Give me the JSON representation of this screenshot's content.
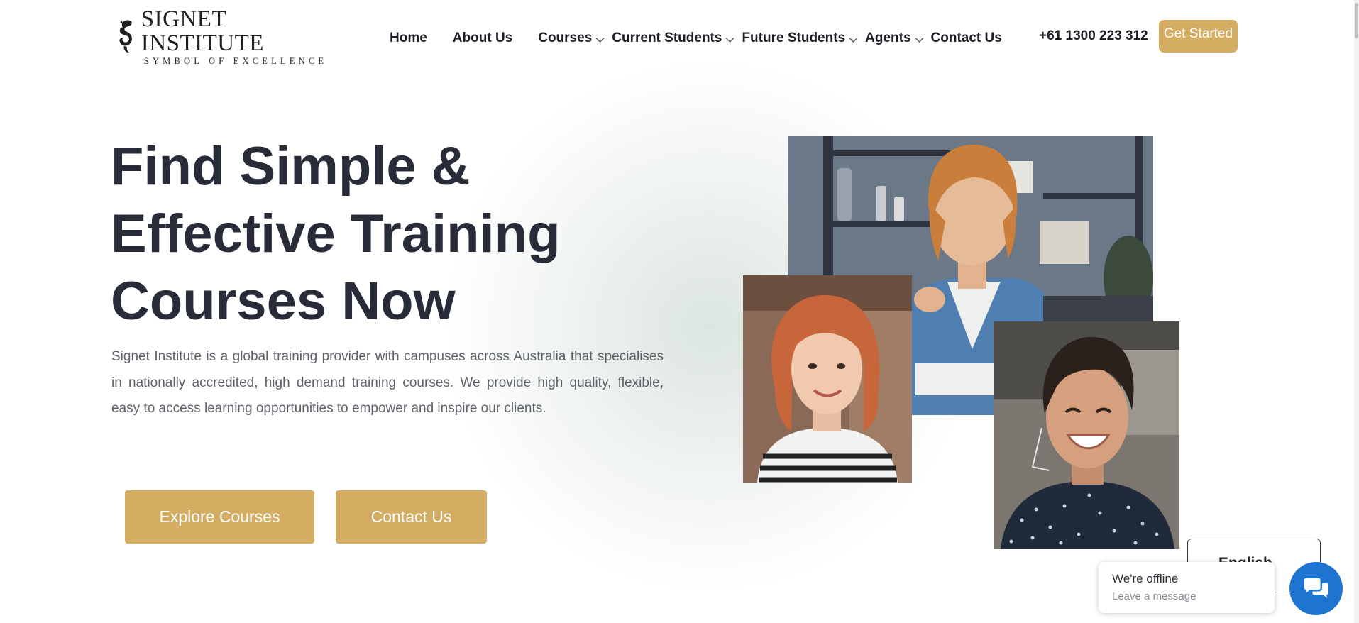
{
  "brand": {
    "name": "SIGNET INSTITUTE",
    "tagline": "SYMBOL OF EXCELLENCE"
  },
  "nav": {
    "items": [
      {
        "label": "Home"
      },
      {
        "label": "About Us"
      },
      {
        "label": "Courses"
      },
      {
        "label": "Current Students"
      },
      {
        "label": "Future Students"
      },
      {
        "label": "Agents"
      },
      {
        "label": "Contact Us"
      }
    ],
    "phone": "+61 1300 223 312",
    "cta": "Get Started"
  },
  "hero": {
    "title_lines": [
      "Find Simple &",
      "Effective Training",
      "Courses Now"
    ],
    "description": "Signet Institute is a global training provider with campuses across Australia that specialises in nationally accredited, high demand training courses. We provide high quality, flexible, easy to access learning opportunities to empower and inspire our clients.",
    "buttons": {
      "explore": "Explore Courses",
      "contact": "Contact Us"
    }
  },
  "language": {
    "selected": "English"
  },
  "chat": {
    "status": "We're offline",
    "prompt": "Leave a message"
  },
  "colors": {
    "accent": "#d5ad62",
    "heading": "#272c38",
    "body_text": "#5d6169",
    "chat_blue": "#1e74d1"
  },
  "icons": {
    "logo": "seahorse-logo-icon",
    "dropdown": "chevron-down-icon",
    "chat": "chat-bubbles-icon"
  }
}
